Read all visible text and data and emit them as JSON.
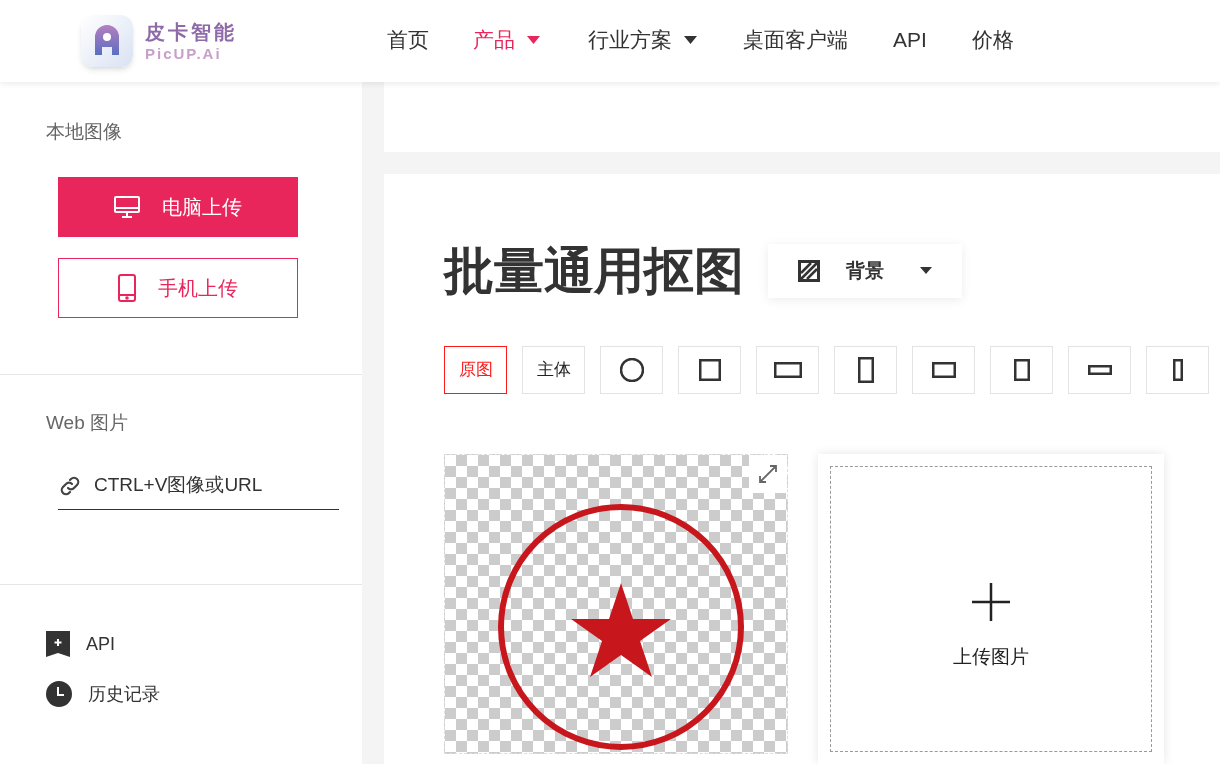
{
  "logo": {
    "name": "皮卡智能",
    "subtitle": "PicUP.Ai"
  },
  "nav": [
    {
      "label": "首页",
      "selected": false,
      "dropdown": false
    },
    {
      "label": "产品",
      "selected": true,
      "dropdown": true
    },
    {
      "label": "行业方案",
      "selected": false,
      "dropdown": true
    },
    {
      "label": "桌面客户端",
      "selected": false,
      "dropdown": false
    },
    {
      "label": "API",
      "selected": false,
      "dropdown": false
    },
    {
      "label": "价格",
      "selected": false,
      "dropdown": false
    }
  ],
  "sidebar": {
    "local_title": "本地图像",
    "upload_buttons": [
      {
        "label": "电脑上传",
        "kind": "computer",
        "selected": true
      },
      {
        "label": "手机上传",
        "kind": "phone",
        "selected": false
      }
    ],
    "web_title": "Web 图片",
    "url_placeholder": "CTRL+V图像或URL",
    "links": [
      {
        "label": "API",
        "kind": "api"
      },
      {
        "label": "历史记录",
        "kind": "history"
      }
    ]
  },
  "main": {
    "title": "批量通用抠图",
    "background_button": "背景",
    "options": [
      {
        "kind": "text",
        "label": "原图",
        "selected": true
      },
      {
        "kind": "text",
        "label": "主体",
        "selected": false
      },
      {
        "kind": "circle",
        "selected": false
      },
      {
        "kind": "square",
        "selected": false
      },
      {
        "kind": "wide",
        "selected": false
      },
      {
        "kind": "tall",
        "selected": false
      },
      {
        "kind": "wide-small",
        "selected": false
      },
      {
        "kind": "tall-small",
        "selected": false
      },
      {
        "kind": "strip",
        "selected": false
      },
      {
        "kind": "narrow",
        "selected": false
      }
    ],
    "upload_card": {
      "label": "上传图片"
    }
  }
}
